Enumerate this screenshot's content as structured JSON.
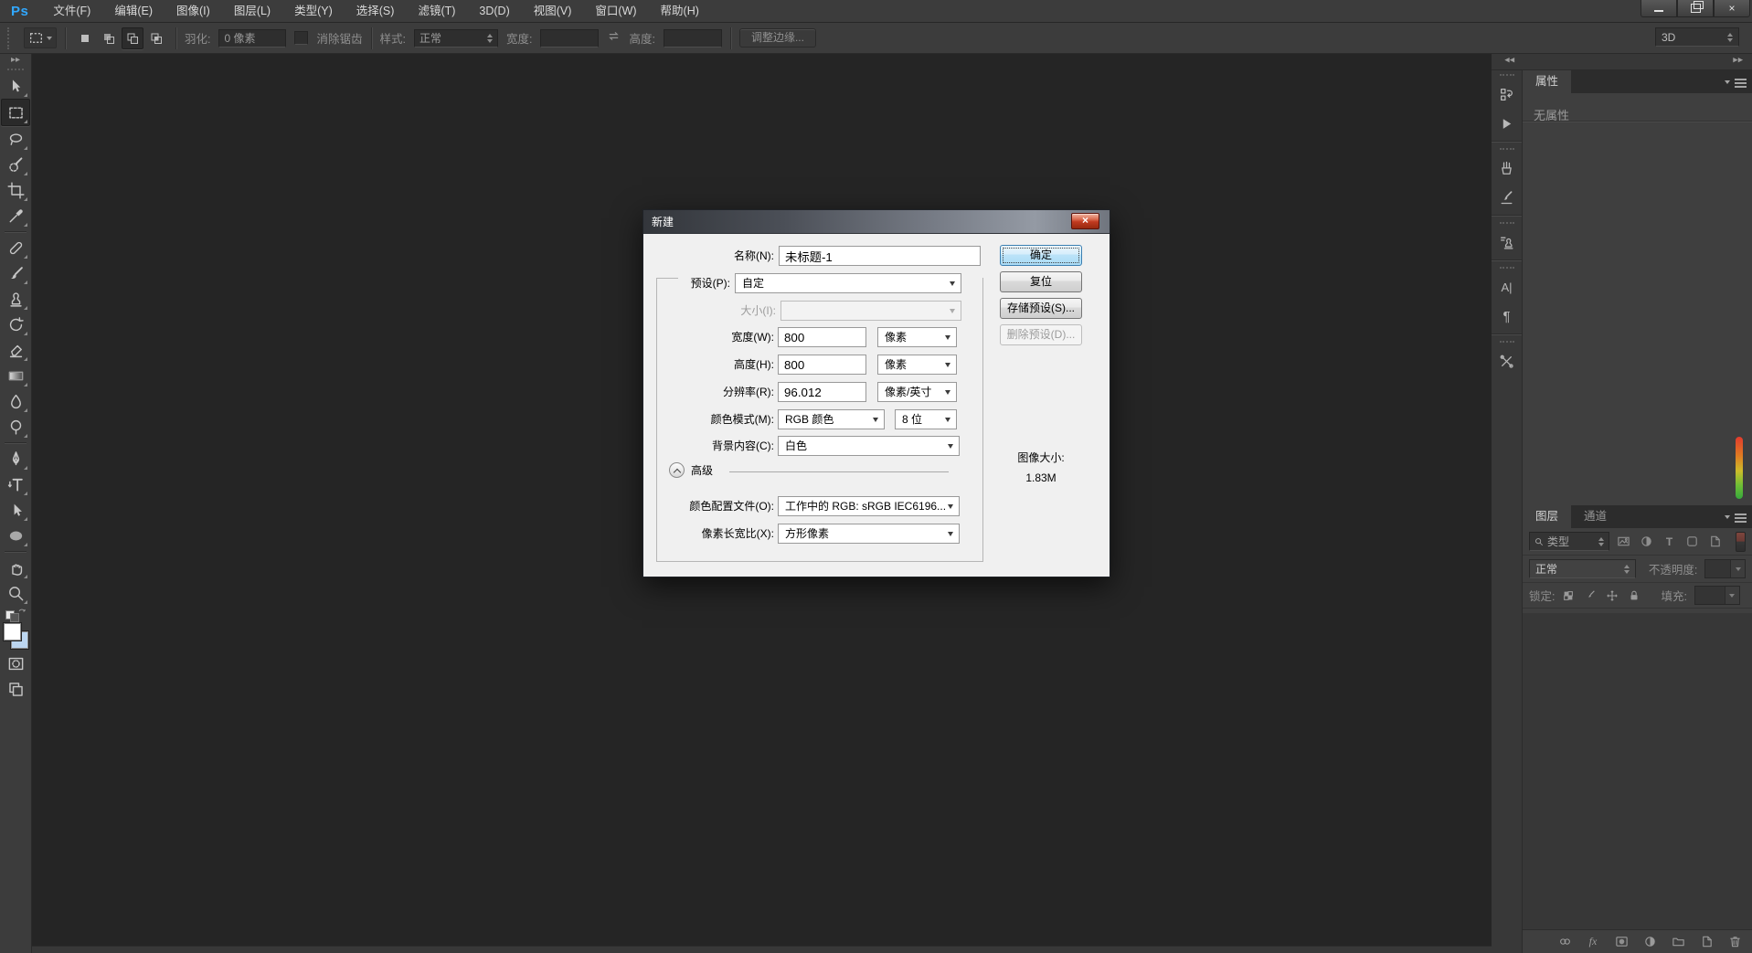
{
  "app": {
    "logo": "Ps",
    "workspace": "3D"
  },
  "menu": {
    "items": [
      "文件(F)",
      "编辑(E)",
      "图像(I)",
      "图层(L)",
      "类型(Y)",
      "选择(S)",
      "滤镜(T)",
      "3D(D)",
      "视图(V)",
      "窗口(W)",
      "帮助(H)"
    ]
  },
  "options_bar": {
    "feather_label": "羽化:",
    "feather_value": "0 像素",
    "antialias_label": "消除锯齿",
    "style_label": "样式:",
    "style_value": "正常",
    "width_label": "宽度:",
    "width_value": "",
    "height_label": "高度:",
    "height_value": "",
    "refine_edge_label": "调整边缘...",
    "workspace": "3D"
  },
  "toolbar": {
    "tools": [
      "move",
      "rectangular-marquee",
      "lasso",
      "quick-selection",
      "crop",
      "eyedropper",
      "spot-healing-brush",
      "brush",
      "clone-stamp",
      "history-brush",
      "eraser",
      "gradient",
      "blur",
      "dodge",
      "pen",
      "vertical-type",
      "path-selection",
      "ellipse-shape",
      "hand",
      "zoom"
    ],
    "selected_tool": "rectangular-marquee",
    "foreground_color": "#ffffff",
    "background_color": "#bcd6f0"
  },
  "new_dialog": {
    "title": "新建",
    "fields": {
      "name_label": "名称(N):",
      "name_value": "未标题-1",
      "preset_label": "预设(P):",
      "preset_value": "自定",
      "size_label": "大小(I):",
      "size_value": "",
      "width_label": "宽度(W):",
      "width_value": "800",
      "width_unit": "像素",
      "height_label": "高度(H):",
      "height_value": "800",
      "height_unit": "像素",
      "resolution_label": "分辨率(R):",
      "resolution_value": "96.012",
      "resolution_unit": "像素/英寸",
      "mode_label": "颜色模式(M):",
      "mode_value": "RGB 颜色",
      "depth_value": "8 位",
      "background_label": "背景内容(C):",
      "background_value": "白色",
      "advanced_label": "高级",
      "profile_label": "颜色配置文件(O):",
      "profile_value": "工作中的 RGB: sRGB IEC6196...",
      "aspect_label": "像素长宽比(X):",
      "aspect_value": "方形像素"
    },
    "buttons": {
      "ok": "确定",
      "reset": "复位",
      "save_preset": "存储预设(S)...",
      "delete_preset": "删除预设(D)..."
    },
    "image_size_label": "图像大小:",
    "image_size_value": "1.83M"
  },
  "right_dock": {
    "panel_strip_icons": [
      "history",
      "actions",
      "brush-presets",
      "brush",
      "clone-source",
      "character",
      "paragraph",
      "tool-presets"
    ],
    "properties_panel": {
      "tab": "属性",
      "empty_text": "无属性"
    },
    "layers_panel": {
      "tab_layers": "图层",
      "tab_channels": "通道",
      "filter_kind_label": "类型",
      "blend_mode": "正常",
      "opacity_label": "不透明度:",
      "lock_label": "锁定:",
      "fill_label": "填充:"
    }
  },
  "glyphs": {
    "close": "×",
    "collapse_left": "◀◀",
    "collapse_right": "▶▶",
    "toolbar_collapse": "▶▶",
    "character_panel": "A|",
    "paragraph_panel": "¶",
    "type_filter": "T",
    "fx": "fx"
  },
  "colors": {
    "logo_blue": "#31a8ff",
    "panel_bg": "#3c3c3c",
    "canvas_bg": "#252525",
    "dialog_bg": "#f0f0f0",
    "ok_button_border": "#3c7fb1",
    "background_swatch": "#bcd6f0"
  }
}
